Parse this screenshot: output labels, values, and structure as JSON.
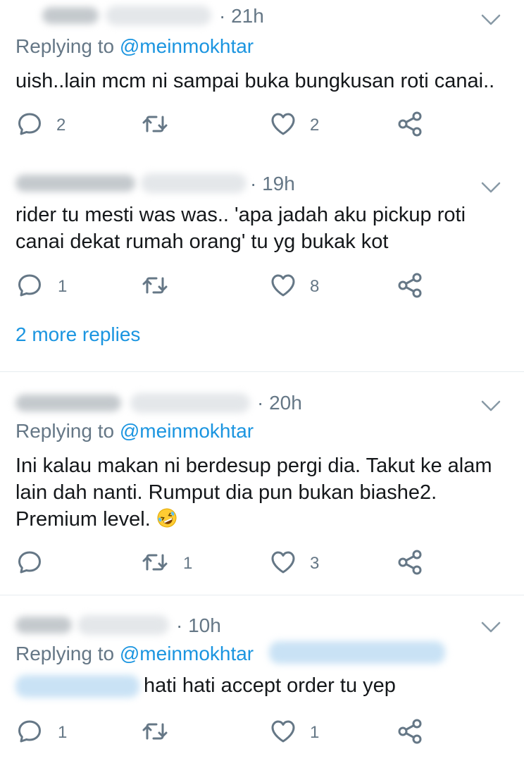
{
  "tweets": [
    {
      "time": "· 21h",
      "replying_prefix": "Replying to ",
      "replying_handle": "@meinmokhtar",
      "text": "uish..lain mcm ni sampai buka bungkusan roti canai..",
      "reply_count": "2",
      "retweet_count": "",
      "like_count": "2"
    },
    {
      "time": "· 19h",
      "text_line1": "rider tu mesti was was.. 'apa jadah aku pickup roti",
      "text_line2": "canai dekat rumah orang' tu yg bukak kot",
      "reply_count": "1",
      "retweet_count": "",
      "like_count": "8"
    },
    {
      "time": "· 20h",
      "replying_prefix": "Replying to ",
      "replying_handle": "@meinmokhtar",
      "text_line1": "Ini kalau makan ni berdesup pergi dia. Takut ke alam",
      "text_line2": "lain dah nanti. Rumput dia pun bukan biashe2.",
      "text_line3": "Premium level.",
      "reply_count": "",
      "retweet_count": "1",
      "like_count": "3"
    },
    {
      "time": "· 10h",
      "replying_prefix": "Replying to ",
      "replying_handle": "@meinmokhtar",
      "text": "hati hati accept order tu yep",
      "reply_count": "1",
      "retweet_count": "",
      "like_count": "1"
    }
  ],
  "more_replies": "2 more replies",
  "colors": {
    "link": "#1b95e0",
    "secondary": "#657786",
    "text": "#14171a",
    "divider": "#e6ecf0"
  },
  "icons": [
    "reply-icon",
    "retweet-icon",
    "like-icon",
    "share-icon",
    "chevron-down-icon",
    "rofl-emoji"
  ]
}
